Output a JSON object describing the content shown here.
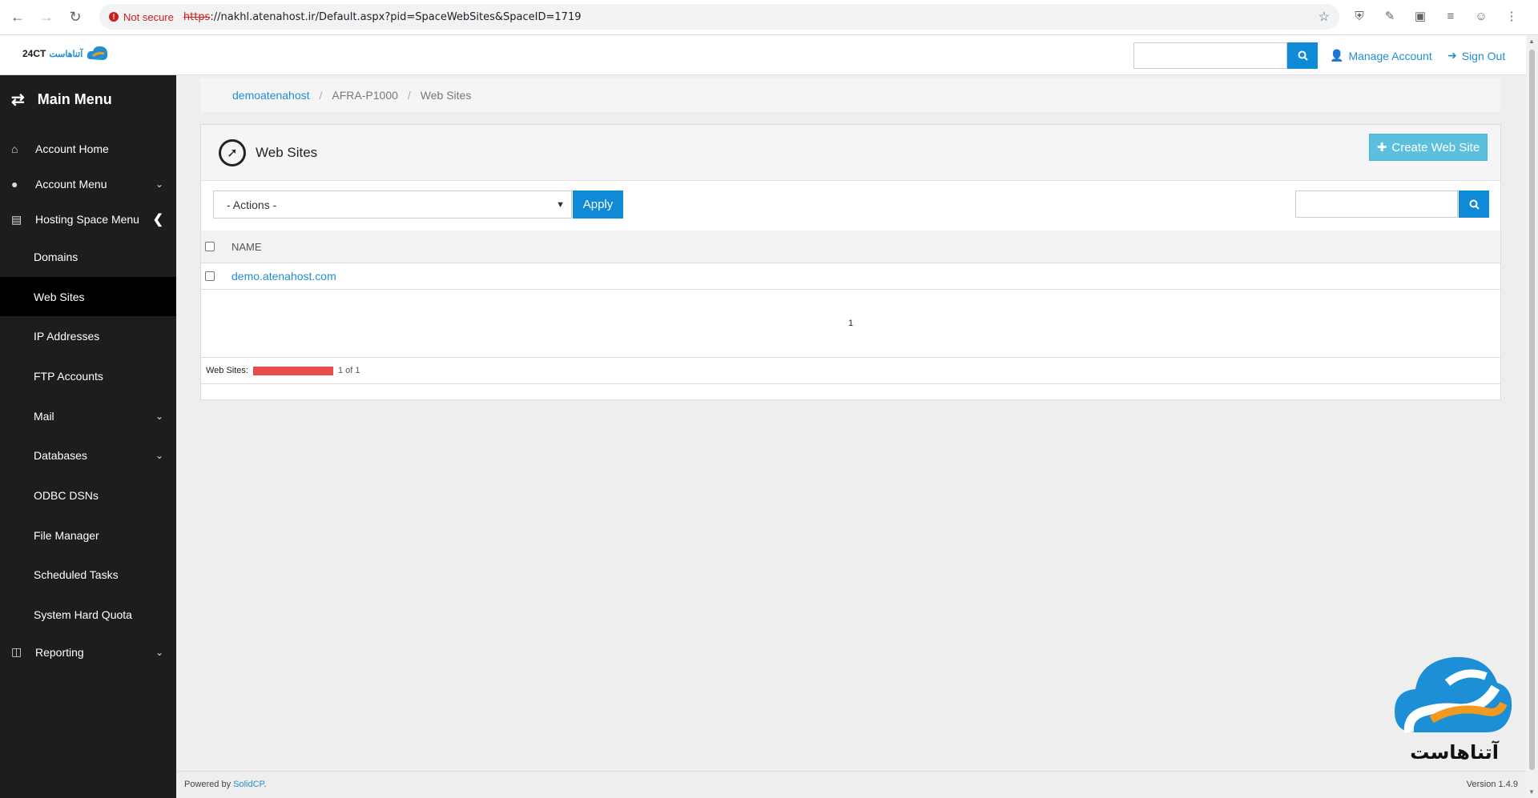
{
  "browser": {
    "security_label": "Not secure",
    "url_proto": "https",
    "url_rest": "://nakhl.atenahost.ir/Default.aspx?pid=SpaceWebSites&SpaceID=1719"
  },
  "header": {
    "logo_text": "24CT",
    "logo_brand": "آتناهاست",
    "manage_account": "Manage Account",
    "sign_out": "Sign Out"
  },
  "sidebar": {
    "title": "Main Menu",
    "account_home": "Account Home",
    "account_menu": "Account Menu",
    "hosting_space_menu": "Hosting Space Menu",
    "items": [
      "Domains",
      "Web Sites",
      "IP Addresses",
      "FTP Accounts",
      "Mail",
      "Databases",
      "ODBC DSNs",
      "File Manager",
      "Scheduled Tasks",
      "System Hard Quota"
    ],
    "reporting": "Reporting"
  },
  "breadcrumb": {
    "item1": "demoatenahost",
    "item2": "AFRA-P1000",
    "item3": "Web Sites"
  },
  "panel": {
    "title": "Web Sites",
    "create_button": "Create Web Site",
    "actions_value": "- Actions -",
    "apply_button": "Apply",
    "col_name": "NAME",
    "rows": [
      "demo.atenahost.com"
    ],
    "page_number": "1",
    "quota_label": "Web Sites:",
    "quota_text": "1 of 1",
    "quota_fraction": 1.0
  },
  "footer": {
    "powered_prefix": "Powered by ",
    "powered_link": "SolidCP",
    "powered_suffix": ".",
    "version": "Version 1.4.9"
  },
  "brand_logo_text": "آتناهاست",
  "colors": {
    "accent_blue": "#0f8ad6",
    "sidebar_bg": "#1d1d1d",
    "create_button": "#5bc0de",
    "quota_bar": "#e74c4c"
  }
}
